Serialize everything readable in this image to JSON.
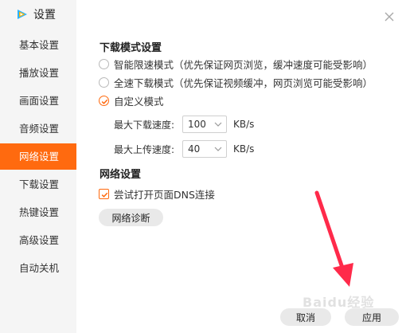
{
  "app": {
    "title": "设置"
  },
  "sidebar": {
    "items": [
      {
        "label": "基本设置",
        "active": false
      },
      {
        "label": "播放设置",
        "active": false
      },
      {
        "label": "画面设置",
        "active": false
      },
      {
        "label": "音频设置",
        "active": false
      },
      {
        "label": "网络设置",
        "active": true
      },
      {
        "label": "下载设置",
        "active": false
      },
      {
        "label": "热键设置",
        "active": false
      },
      {
        "label": "高级设置",
        "active": false
      },
      {
        "label": "自动关机",
        "active": false
      }
    ]
  },
  "download_mode": {
    "title": "下载模式设置",
    "options": [
      {
        "label": "智能限速模式（优先保证网页浏览，缓冲速度可能受影响）",
        "selected": false
      },
      {
        "label": "全速下载模式（优先保证视频缓冲，网页浏览可能受影响）",
        "selected": false
      },
      {
        "label": "自定义模式",
        "selected": true
      }
    ],
    "max_download": {
      "label": "最大下载速度:",
      "value": "100",
      "unit": "KB/s"
    },
    "max_upload": {
      "label": "最大上传速度:",
      "value": "40",
      "unit": "KB/s"
    }
  },
  "network": {
    "title": "网络设置",
    "dns_checkbox": {
      "label": "尝试打开页面DNS连接",
      "checked": true
    },
    "diagnose_button": "网络诊断"
  },
  "footer": {
    "cancel": "取消",
    "apply": "应用"
  },
  "watermark": "Baidu经验",
  "colors": {
    "accent": "#ff6a0f",
    "arrow": "#ff2a4a",
    "sidebar_bg": "#f5f5f5"
  },
  "icons": {
    "logo": "tencent-video-logo",
    "close": "close-icon",
    "chevron": "chevron-down-icon",
    "check": "check-icon"
  }
}
